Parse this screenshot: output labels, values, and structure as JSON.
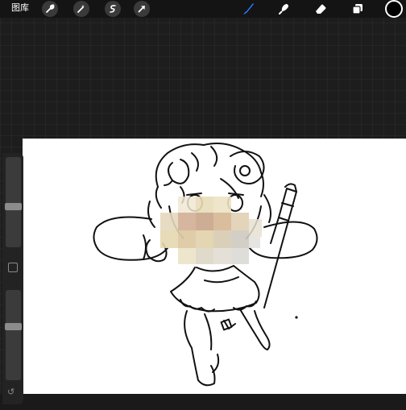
{
  "toolbar": {
    "gallery_label": "图库",
    "left_tools": [
      "wrench-icon",
      "magic-wand-icon",
      "selection-icon",
      "transform-arrow-icon"
    ],
    "right_tools": [
      "brush-icon",
      "smudge-icon",
      "eraser-icon",
      "layers-icon"
    ],
    "brush_accent": "#2a7fff",
    "current_color": "#000000"
  },
  "sidebar": {
    "brush_size_level": 0.45,
    "opacity_level": 0.6,
    "modify_button": "modify-square-icon",
    "undo_icon": "↺"
  },
  "canvas": {
    "background": "#ffffff",
    "content": "line-art-character-with-mosaic-face"
  }
}
